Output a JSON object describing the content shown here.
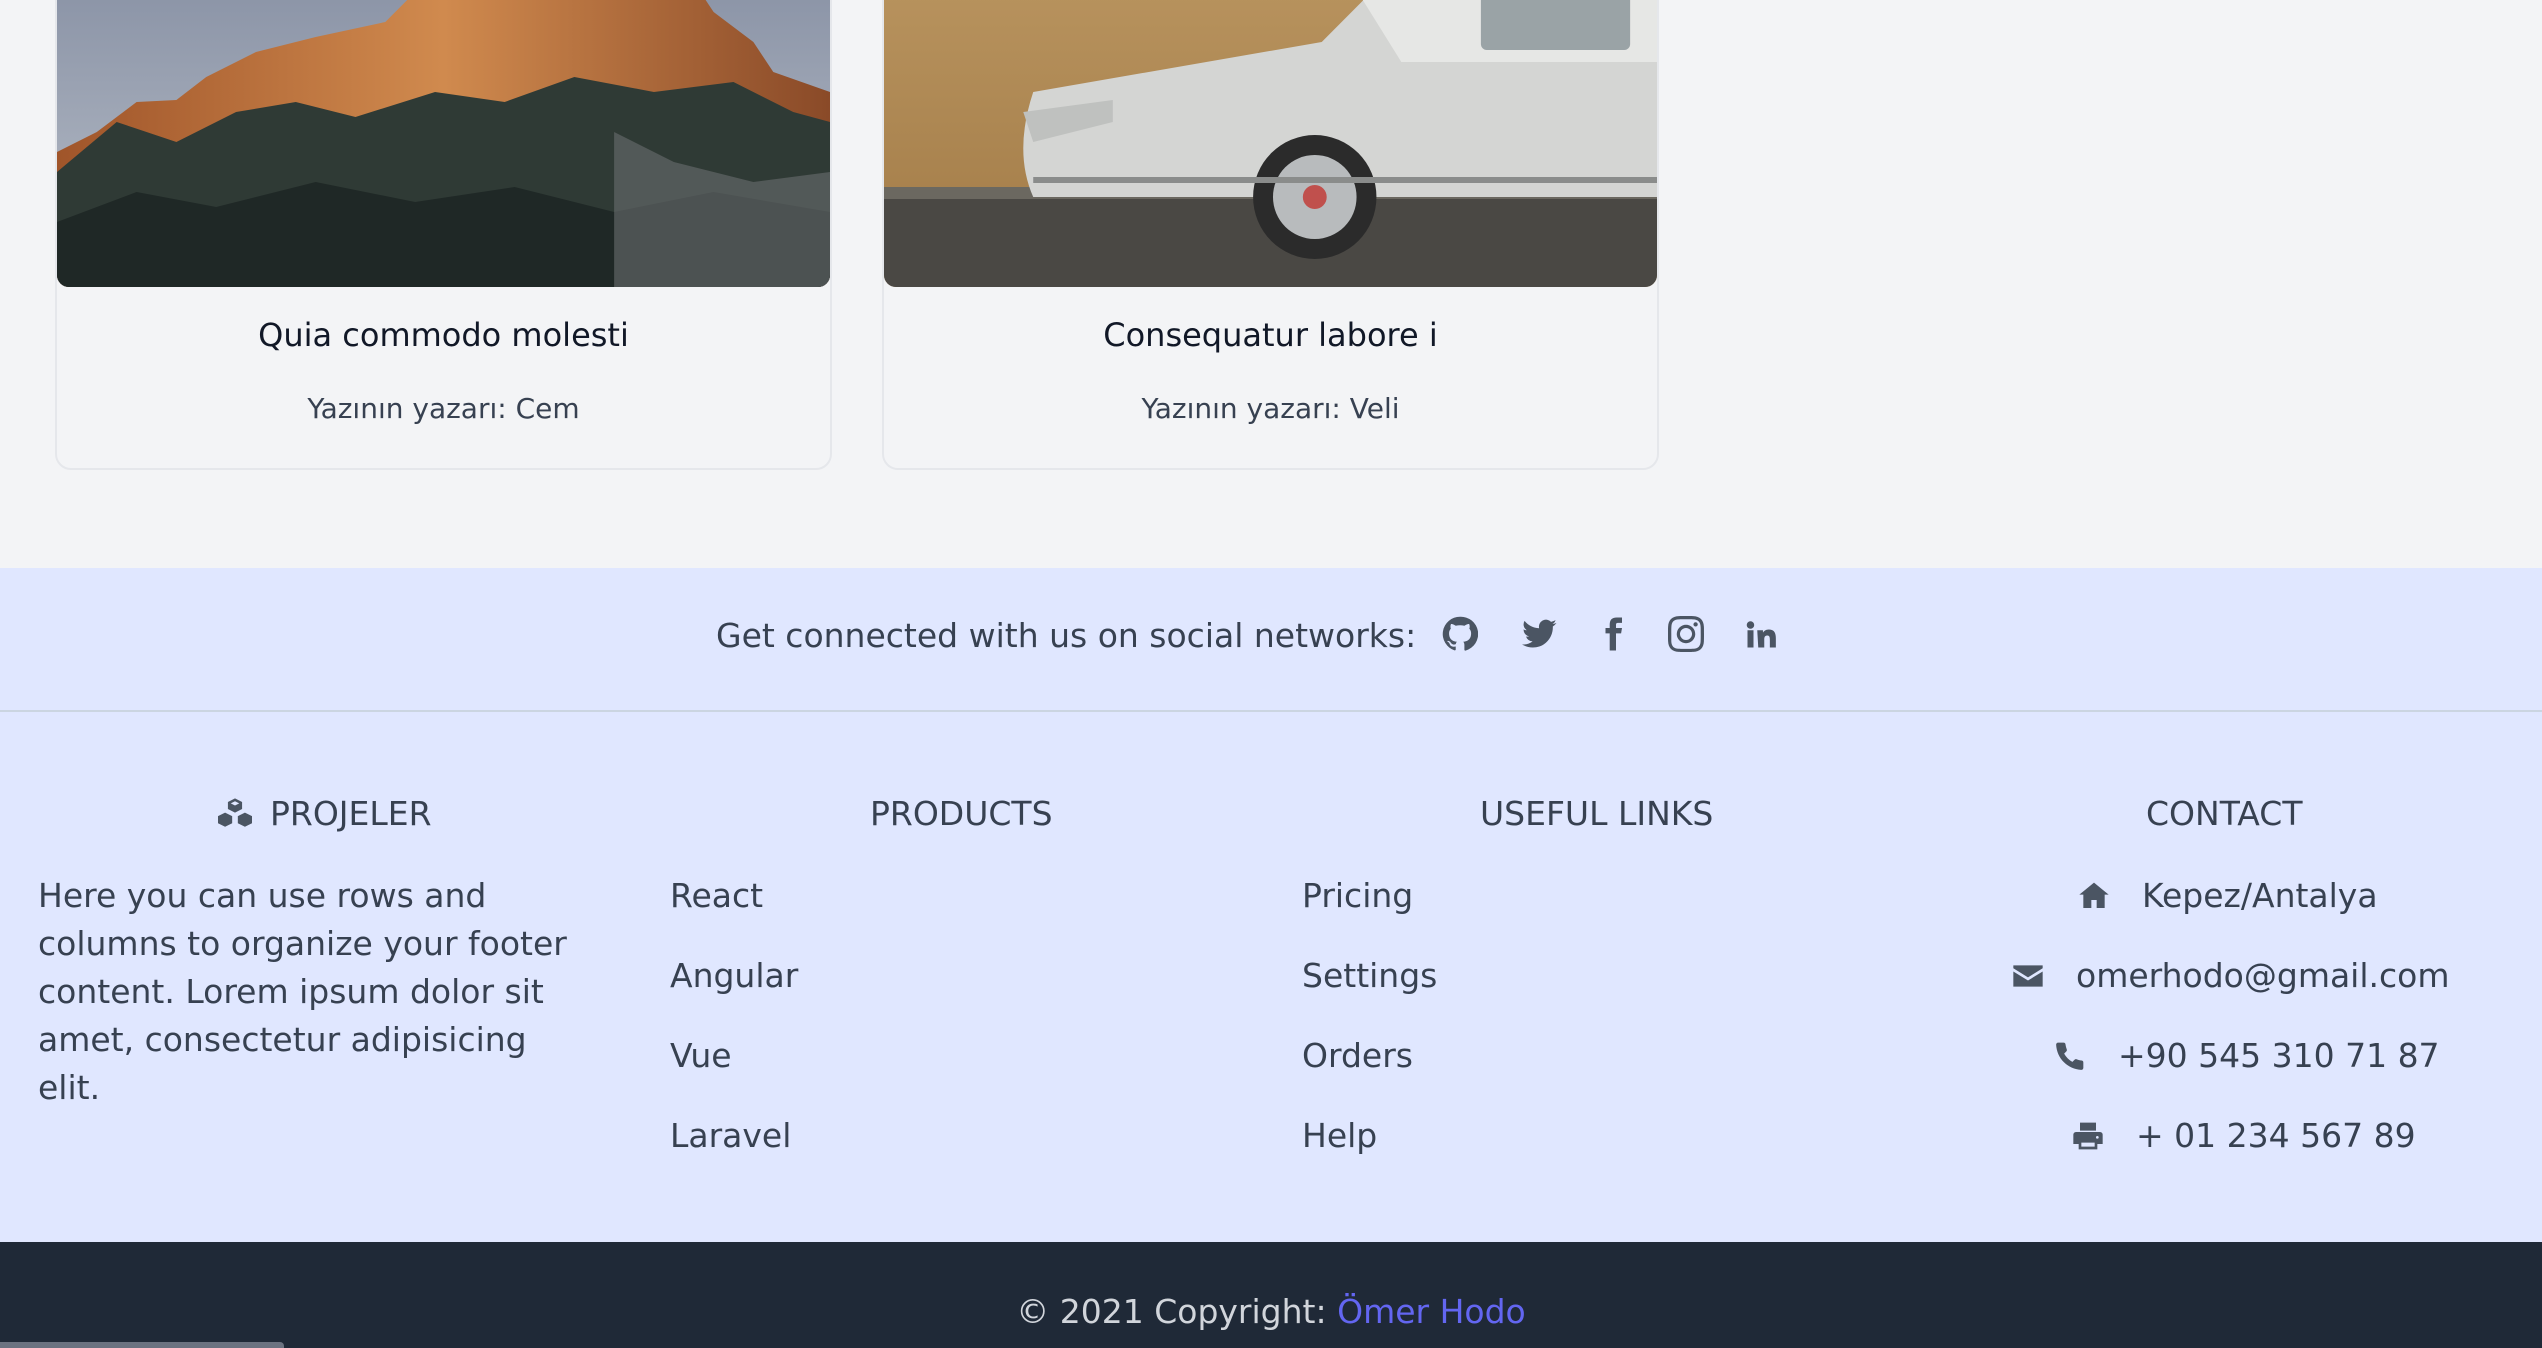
{
  "posts": [
    {
      "title": "Quia commodo molesti",
      "author": "Yazının yazarı: Cem",
      "image": "mountain-photo"
    },
    {
      "title": "Consequatur labore i",
      "author": "Yazının yazarı: Veli",
      "image": "vintage-car-photo"
    }
  ],
  "social": {
    "text": "Get connected with us on social networks:",
    "icons": [
      "github-icon",
      "twitter-icon",
      "facebook-icon",
      "instagram-icon",
      "linkedin-icon"
    ]
  },
  "about": {
    "title": "PROJELER",
    "icon": "cubes-icon",
    "text": "Here you can use rows and columns to organize your footer content. Lorem ipsum dolor sit amet, consectetur adipisicing elit."
  },
  "products": {
    "title": "PRODUCTS",
    "items": [
      "React",
      "Angular",
      "Vue",
      "Laravel"
    ]
  },
  "useful_links": {
    "title": "USEFUL LINKS",
    "items": [
      "Pricing",
      "Settings",
      "Orders",
      "Help"
    ]
  },
  "contact": {
    "title": "CONTACT",
    "address": "Kepez/Antalya",
    "email": "omerhodo@gmail.com",
    "phone": "+90 545 310 71 87",
    "fax": "+ 01 234 567 89"
  },
  "copyright": {
    "prefix": "© 2021 Copyright:",
    "author": "Ömer Hodo"
  },
  "colors": {
    "footer_bg": "#e0e7ff",
    "copyright_bg": "#1f2937",
    "accent": "#6366f1",
    "page_bg": "#f3f4f6"
  }
}
